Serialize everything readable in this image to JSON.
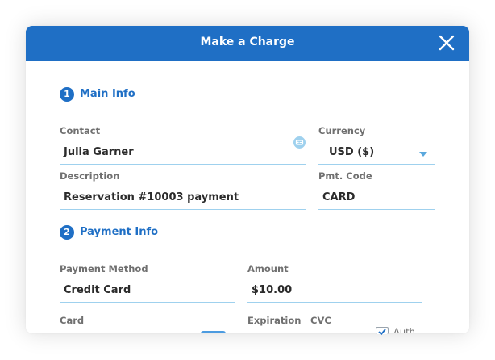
{
  "modal": {
    "title": "Make a Charge",
    "close_icon": "close-icon"
  },
  "sections": {
    "main": {
      "number": "1",
      "title": "Main Info"
    },
    "payment": {
      "number": "2",
      "title": "Payment Info"
    }
  },
  "fields": {
    "contact": {
      "label": "Contact",
      "value": "Julia Garner",
      "icon": "contact-card-icon"
    },
    "currency": {
      "label": "Currency",
      "value": "USD ($)",
      "icon": "chevron-down-icon"
    },
    "description": {
      "label": "Description",
      "value": "Reservation #10003 payment"
    },
    "pmt_code": {
      "label": "Pmt. Code",
      "value": "CARD"
    },
    "payment_method": {
      "label": "Payment Method",
      "value": "Credit Card"
    },
    "amount": {
      "label": "Amount",
      "value": "$10.00"
    },
    "card": {
      "label": "Card"
    },
    "expiration": {
      "label": "Expiration"
    },
    "cvc": {
      "label": "CVC"
    },
    "auth": {
      "label": "Auth",
      "checked": true
    }
  },
  "colors": {
    "accent": "#1f6fc5",
    "field_border": "#9fd1ee",
    "label": "#707070",
    "text": "#2b2b2b"
  }
}
